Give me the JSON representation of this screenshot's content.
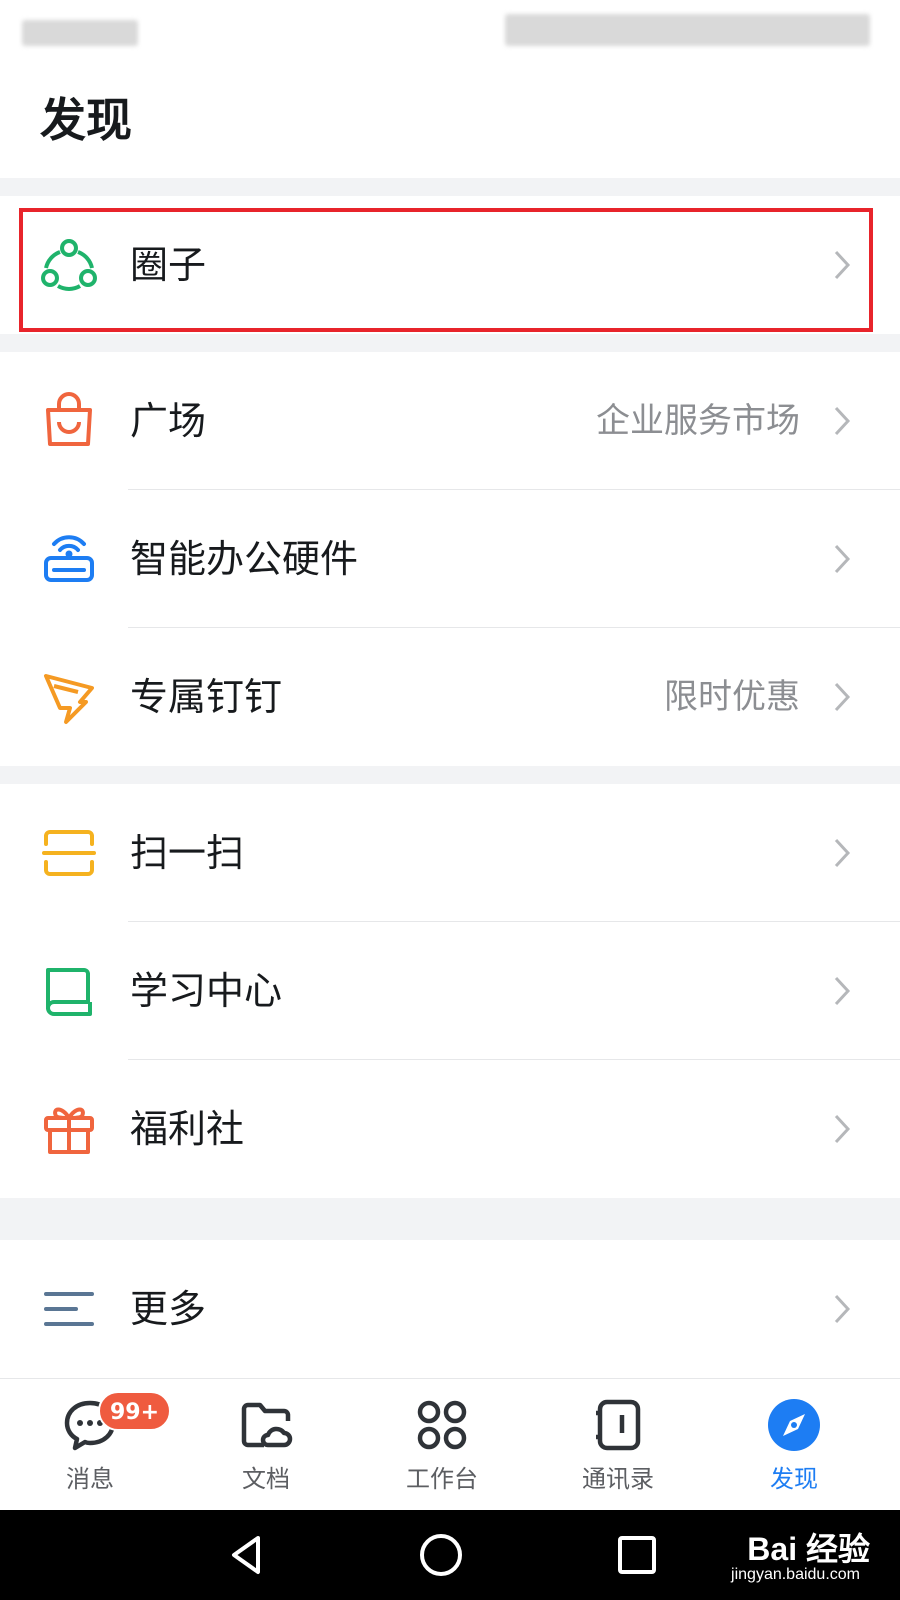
{
  "header": {
    "title": "发现"
  },
  "groups": [
    {
      "items": [
        {
          "label": "圈子",
          "sub": "",
          "icon": "circle-group-icon",
          "color": "#1fb36b"
        }
      ]
    },
    {
      "items": [
        {
          "label": "广场",
          "sub": "企业服务市场",
          "icon": "shopping-bag-icon",
          "color": "#f0653e"
        },
        {
          "label": "智能办公硬件",
          "sub": "",
          "icon": "smart-hardware-icon",
          "color": "#1d7df3"
        },
        {
          "label": "专属钉钉",
          "sub": "限时优惠",
          "icon": "dingtalk-wing-icon",
          "color": "#f59a23"
        }
      ]
    },
    {
      "items": [
        {
          "label": "扫一扫",
          "sub": "",
          "icon": "scan-icon",
          "color": "#f5b21f"
        },
        {
          "label": "学习中心",
          "sub": "",
          "icon": "book-icon",
          "color": "#1fb36b"
        },
        {
          "label": "福利社",
          "sub": "",
          "icon": "gift-icon",
          "color": "#f0653e"
        }
      ]
    },
    {
      "items": [
        {
          "label": "更多",
          "sub": "",
          "icon": "menu-lines-icon",
          "color": "#5a7694"
        }
      ]
    }
  ],
  "tabbar": {
    "tabs": [
      {
        "label": "消息",
        "icon": "chat-bubble-icon",
        "badge": "99+"
      },
      {
        "label": "文档",
        "icon": "folder-cloud-icon"
      },
      {
        "label": "工作台",
        "icon": "grid-apps-icon"
      },
      {
        "label": "通讯录",
        "icon": "contacts-book-icon"
      },
      {
        "label": "发现",
        "icon": "compass-icon",
        "active": true
      }
    ],
    "active_color": "#1d7df3"
  },
  "watermark": {
    "main": "Bai 经验",
    "sub": "jingyan.baidu.com"
  }
}
